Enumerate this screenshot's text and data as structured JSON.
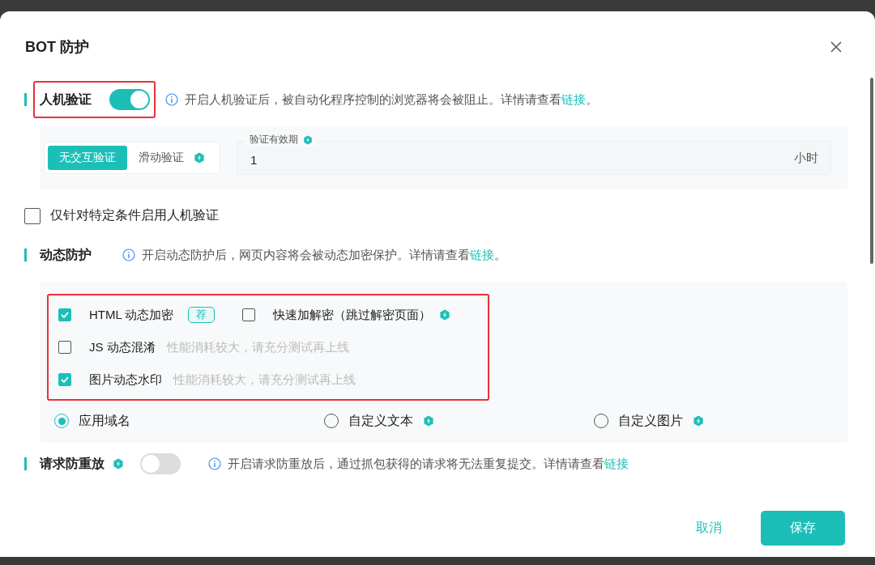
{
  "dialog": {
    "title": "BOT 防护"
  },
  "captcha": {
    "label": "人机验证",
    "on": true,
    "info": "开启人机验证后，被自动化程序控制的浏览器将会被阻止。详情请查看",
    "link": "链接",
    "suffix": "。",
    "modes": [
      {
        "label": "无交互验证",
        "selected": true,
        "pro": false
      },
      {
        "label": "滑动验证",
        "selected": false,
        "pro": true
      }
    ],
    "validity": {
      "label": "验证有效期",
      "pro": true,
      "value": "1",
      "unit": "小时"
    },
    "condition": {
      "label": "仅针对特定条件启用人机验证",
      "checked": false
    }
  },
  "dynamic": {
    "label": "动态防护",
    "info": "开启动态防护后，网页内容将会被动态加密保护。详情请查看",
    "link": "链接",
    "suffix": "。",
    "option_rows": [
      [
        {
          "label": "HTML 动态加密",
          "checked": true,
          "badge": "荐",
          "pro": false
        },
        {
          "label": "快速加解密（跳过解密页面）",
          "checked": false,
          "pro": true
        }
      ],
      [
        {
          "label": "JS 动态混淆",
          "checked": false,
          "hint": "性能消耗较大，请充分测试再上线",
          "pro": false
        }
      ],
      [
        {
          "label": "图片动态水印",
          "checked": true,
          "hint": "性能消耗较大，请充分测试再上线",
          "pro": false
        }
      ]
    ],
    "watermark": [
      {
        "label": "应用域名",
        "selected": true,
        "pro": false
      },
      {
        "label": "自定义文本",
        "selected": false,
        "pro": true
      },
      {
        "label": "自定义图片",
        "selected": false,
        "pro": true
      }
    ]
  },
  "replay": {
    "label": "请求防重放",
    "pro": true,
    "on": false,
    "info": "开启请求防重放后，通过抓包获得的请求将无法重复提交。详情请查看",
    "link": "链接"
  },
  "footer": {
    "cancel": "取消",
    "save": "保存"
  }
}
